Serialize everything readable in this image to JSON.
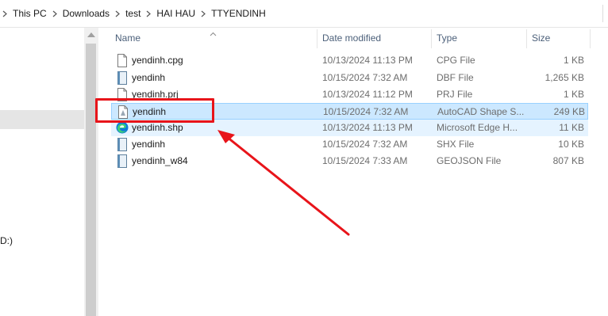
{
  "breadcrumb": {
    "items": [
      "This PC",
      "Downloads",
      "test",
      "HAI HAU",
      "TTYENDINH"
    ]
  },
  "nav": {
    "drive_label_fragment": "D:)"
  },
  "columns": {
    "name": "Name",
    "date": "Date modified",
    "type": "Type",
    "size": "Size"
  },
  "files": [
    {
      "name": "yendinh.cpg",
      "date": "10/13/2024 11:13 PM",
      "type": "CPG File",
      "size": "1 KB",
      "icon": "text-file-icon"
    },
    {
      "name": "yendinh",
      "date": "10/15/2024 7:32 AM",
      "type": "DBF File",
      "size": "1,265 KB",
      "icon": "data-file-icon"
    },
    {
      "name": "yendinh.prj",
      "date": "10/13/2024 11:12 PM",
      "type": "PRJ File",
      "size": "1 KB",
      "icon": "text-file-icon"
    },
    {
      "name": "yendinh",
      "date": "10/15/2024 7:32 AM",
      "type": "AutoCAD Shape S...",
      "size": "249 KB",
      "icon": "autocad-shape-file-icon"
    },
    {
      "name": "yendinh.shp",
      "date": "10/13/2024 11:13 PM",
      "type": "Microsoft Edge H...",
      "size": "11 KB",
      "icon": "edge-icon"
    },
    {
      "name": "yendinh",
      "date": "10/15/2024 7:32 AM",
      "type": "SHX File",
      "size": "10 KB",
      "icon": "data-file-icon"
    },
    {
      "name": "yendinh_w84",
      "date": "10/15/2024 7:33 AM",
      "type": "GEOJSON File",
      "size": "807 KB",
      "icon": "data-file-icon"
    }
  ],
  "colors": {
    "selection_bg": "#cce8ff",
    "selection_border": "#99d1ff",
    "hover_bg": "#e5f3ff",
    "annotation_red": "#e8141a",
    "header_text": "#4c607a"
  }
}
